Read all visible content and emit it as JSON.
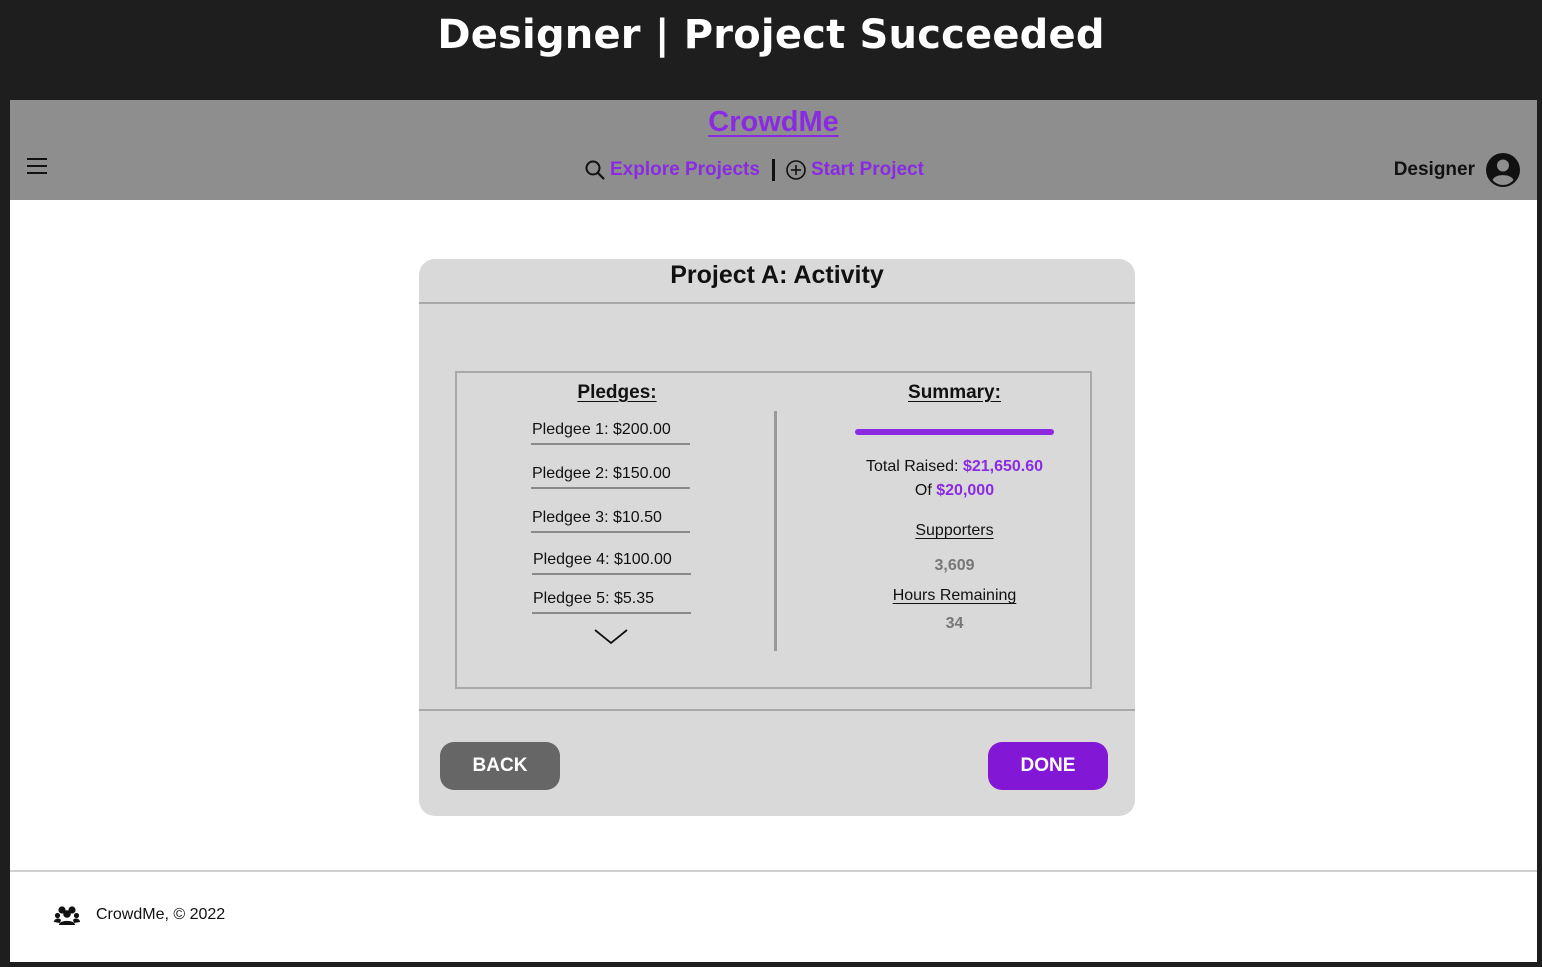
{
  "frame": {
    "title": "Designer | Project Succeeded"
  },
  "navbar": {
    "brand": "CrowdMe",
    "menu_icon": "hamburger-menu-icon",
    "links": [
      {
        "label": "Explore Projects",
        "icon": "search-icon"
      },
      {
        "label": "Start Project",
        "icon": "plus-circle-icon"
      }
    ],
    "user": {
      "name": "Designer",
      "icon": "user-avatar-icon"
    }
  },
  "card": {
    "title": "Project A: Activity",
    "pledges": {
      "heading": "Pledges:",
      "items": [
        "Pledgee 1: $200.00",
        "Pledgee 2: $150.00",
        "Pledgee 3: $10.50",
        "Pledgee 4: $100.00",
        "Pledgee 5: $5.35"
      ],
      "more_icon": "chevron-down-icon"
    },
    "summary": {
      "heading": "Summary:",
      "progress_fraction": 1.0,
      "total_raised_label": "Total Raised:",
      "total_raised_value": "$21,650.60",
      "goal_label": "Of",
      "goal_value": "$20,000",
      "supporters_label": "Supporters",
      "supporters_value": "3,609",
      "hours_label": "Hours Remaining",
      "hours_value": "34"
    },
    "buttons": {
      "back": "BACK",
      "done": "DONE"
    }
  },
  "footer": {
    "icon": "group-icon",
    "text": "CrowdMe, © 2022"
  },
  "colors": {
    "accent": "#8a2be2",
    "navbar": "#8e8e8e",
    "card": "#d9d9d9",
    "back_button": "#666666",
    "done_button": "#8317d6"
  }
}
